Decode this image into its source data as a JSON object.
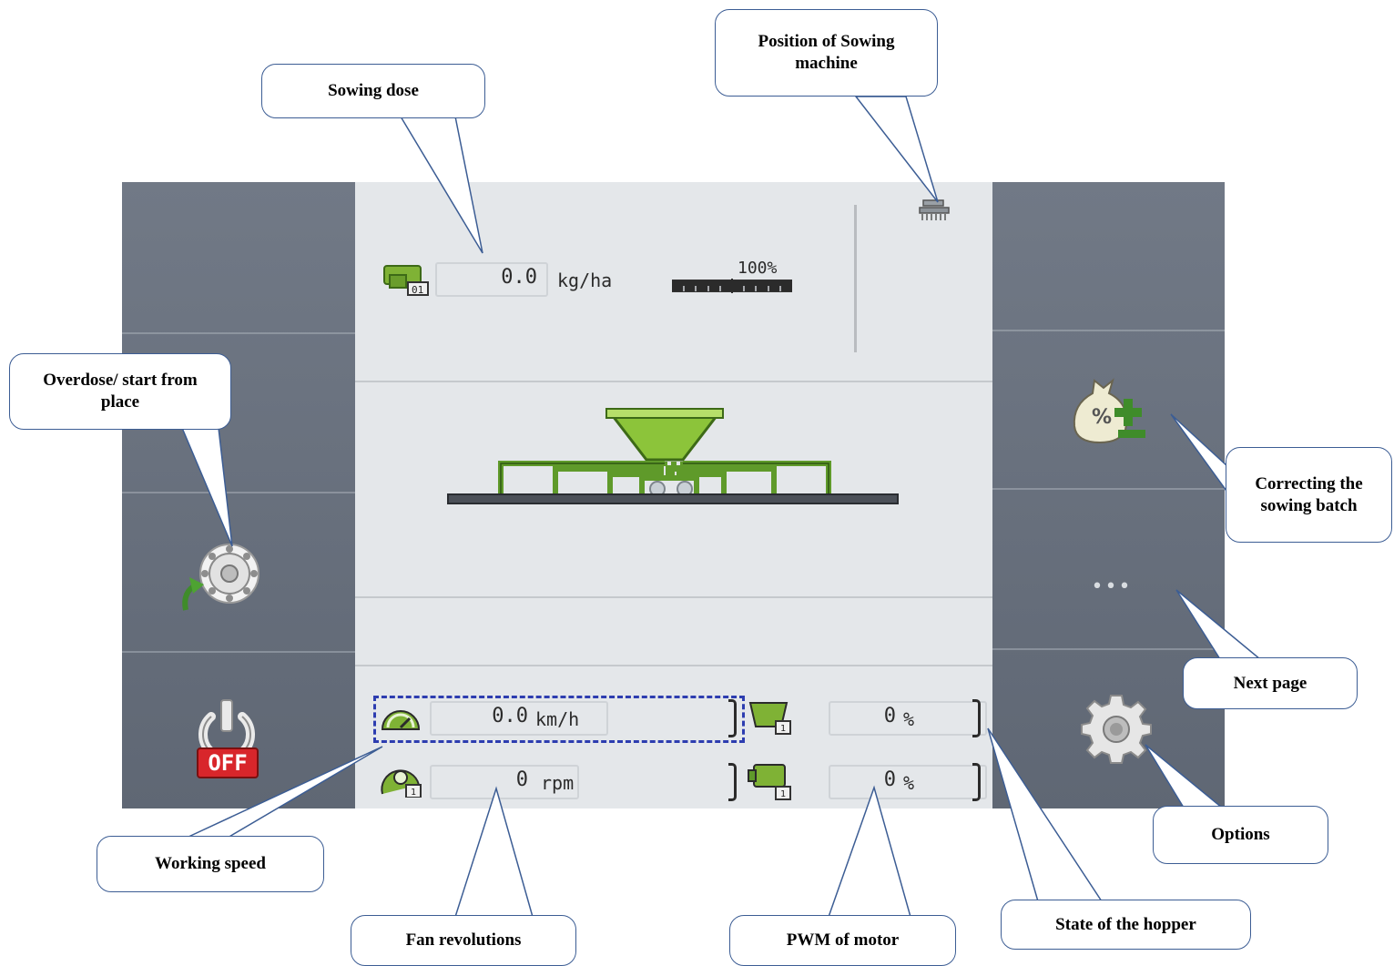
{
  "screen": {
    "sowing_dose": {
      "value": "0.0",
      "unit": "kg/ha"
    },
    "dose_percent": "100%",
    "working_speed": {
      "value": "0.0",
      "unit": "km/h"
    },
    "fan_revolutions": {
      "value": "0",
      "unit": "rpm"
    },
    "hopper_state": {
      "value": "0",
      "unit": "%"
    },
    "motor_pwm": {
      "value": "0",
      "unit": "%"
    },
    "off_button_label": "OFF",
    "next_page_label": "•••",
    "bag_icon_label": "%"
  },
  "callouts": {
    "sowing_dose": "Sowing dose",
    "position_of_sowing_machine": "Position of Sowing machine",
    "overdose_start": "Overdose/ start from place",
    "correcting_batch": "Correcting the sowing batch",
    "next_page": "Next page",
    "options": "Options",
    "working_speed": "Working speed",
    "fan_revolutions": "Fan revolutions",
    "pwm_of_motor": "PWM of motor",
    "state_of_hopper": "State of the hopper"
  },
  "colors": {
    "hopper_green": "#8cc43a",
    "pipe_green": "#5f9a2a",
    "off_red": "#d8262b",
    "focus_blue": "#2d3db0"
  }
}
